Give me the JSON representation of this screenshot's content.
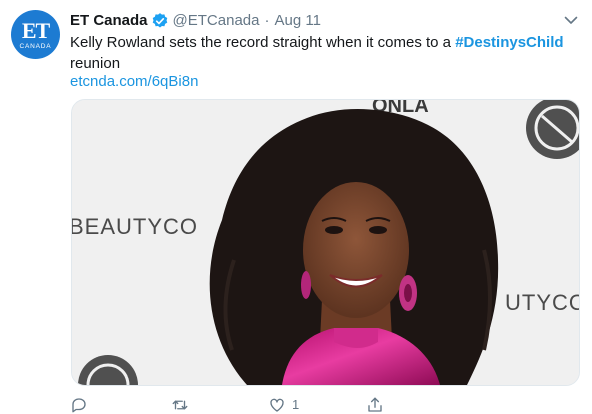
{
  "account": {
    "avatar_text": "ET",
    "avatar_subtext": "CANADA",
    "name": "ET Canada",
    "handle": "@ETCanada",
    "separator": "·",
    "date": "Aug 11"
  },
  "tweet": {
    "text": "Kelly Rowland sets the record straight when it comes to a ",
    "hashtag": "#DestinysChild",
    "text_continued": "reunion",
    "link": "etcnda.com/6qBi8n"
  },
  "media": {
    "backdrop_text_top": "ONLA",
    "backdrop_text_left": "BEAUTYCO",
    "backdrop_text_right": "UTYCO"
  },
  "actions": {
    "reply_icon": "reply-icon",
    "retweet_icon": "retweet-icon",
    "like_icon": "heart-icon",
    "like_count": "1",
    "share_icon": "share-icon"
  },
  "colors": {
    "link": "#1b95e0",
    "secondary_text": "#657786",
    "avatar": "#1d7bd2"
  }
}
